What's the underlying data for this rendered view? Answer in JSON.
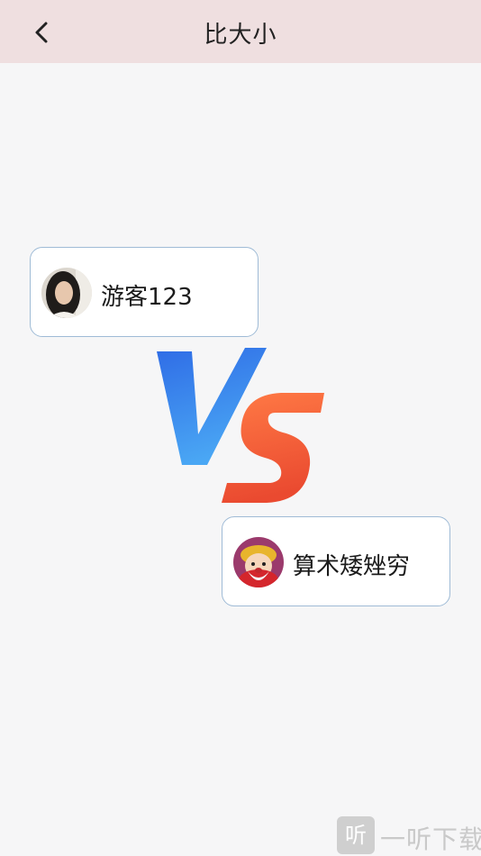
{
  "header": {
    "title": "比大小",
    "back_icon": "chevron-left-icon"
  },
  "players": [
    {
      "name": "游客123",
      "avatar": "girl-portrait-avatar"
    },
    {
      "name": "算术矮矬穷",
      "avatar": "fortune-god-cartoon-avatar"
    }
  ],
  "vs": {
    "v_color": "#3d7de6",
    "s_color": "#f2603c"
  },
  "watermark": {
    "icon_text": "听",
    "text": "一听下载"
  }
}
